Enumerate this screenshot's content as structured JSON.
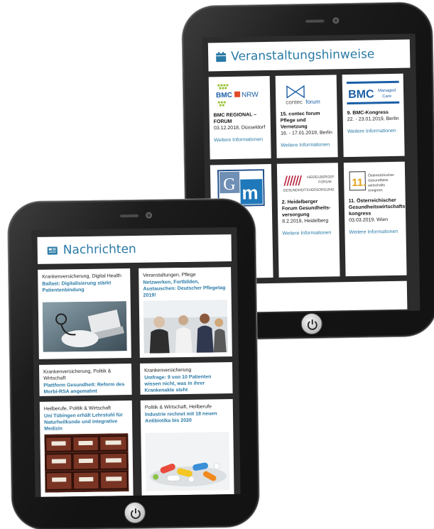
{
  "back": {
    "title": "Veranstaltungshinweise",
    "title_icon": "calendar-icon",
    "events": [
      {
        "logo": "BMC NRW Regional",
        "title": "BMC REGIONAL – FORUM",
        "date": "03.12.2018, Düsseldorf",
        "more": "Weitere Informationen"
      },
      {
        "logo": "contec forum",
        "title": "15. contec forum Pflege und Vernetzung",
        "date": "16. - 17.01.2019, Berlin",
        "more": "Weitere Informationen"
      },
      {
        "logo": "BMC Managed Care",
        "title": "9. BMC-Kongress",
        "date": "22. - 23.01.2019, Berlin",
        "more": "Weitere Informationen"
      },
      {
        "logo": "Gm",
        "title": "",
        "date": "",
        "more": ""
      },
      {
        "logo": "HEIDELBERGER FORUM GESUNDHEITSVERSORGUNG",
        "title": "2. Heidelberger Forum Gesundheits-versorgung",
        "date": "8.2.2019, Heidelberg",
        "more": "Weitere Informationen"
      },
      {
        "logo": "11. Österreichischer Gesundheits-wirtschafts-kongress",
        "title": "11. Österreichischer Gesundheitswirtschafts-kongress",
        "date": "03.03.2019, Wien",
        "more": "Weitere Informationen"
      }
    ]
  },
  "front": {
    "title": "Nachrichten",
    "title_icon": "newspaper-icon",
    "news": [
      {
        "category": "Krankenversicherung, Digital Health",
        "title": "Ballast: Digitalisierung stärkt Patientenbindung",
        "image": "doctor-laptop-photo"
      },
      {
        "category": "Veranstaltungen, Pflege",
        "title": "Netzwerken, Fortbilden, Austauschen: Deutscher Pflegetag 2019!",
        "image": "conference-people-photo"
      },
      {
        "category": "Krankenversicherung, Politik & Wirtschaft",
        "title": "Plattform Gesundheit: Reform des Morbi-RSA angemahnt",
        "image": ""
      },
      {
        "category": "Krankenversicherung",
        "title": "Umfrage: 9 von 10 Patienten wissen nicht, was in ihrer Krankenakte steht",
        "image": ""
      },
      {
        "category": "Heilberufe, Politik & Wirtschaft",
        "title": "Uni Tübingen erhält Lehrstuhl für Naturheilkunde und integrative Medizin",
        "image": "apothecary-drawers-photo"
      },
      {
        "category": "Politik & Wirtschaft, Heilberufe",
        "title": "Industrie rechnet mit 18 neuen Antibiotika bis 2020",
        "image": "pills-photo"
      }
    ]
  },
  "colors": {
    "accent": "#2a7aa6",
    "bezel": "#131313",
    "screen_bg": "#2c2c2c"
  }
}
